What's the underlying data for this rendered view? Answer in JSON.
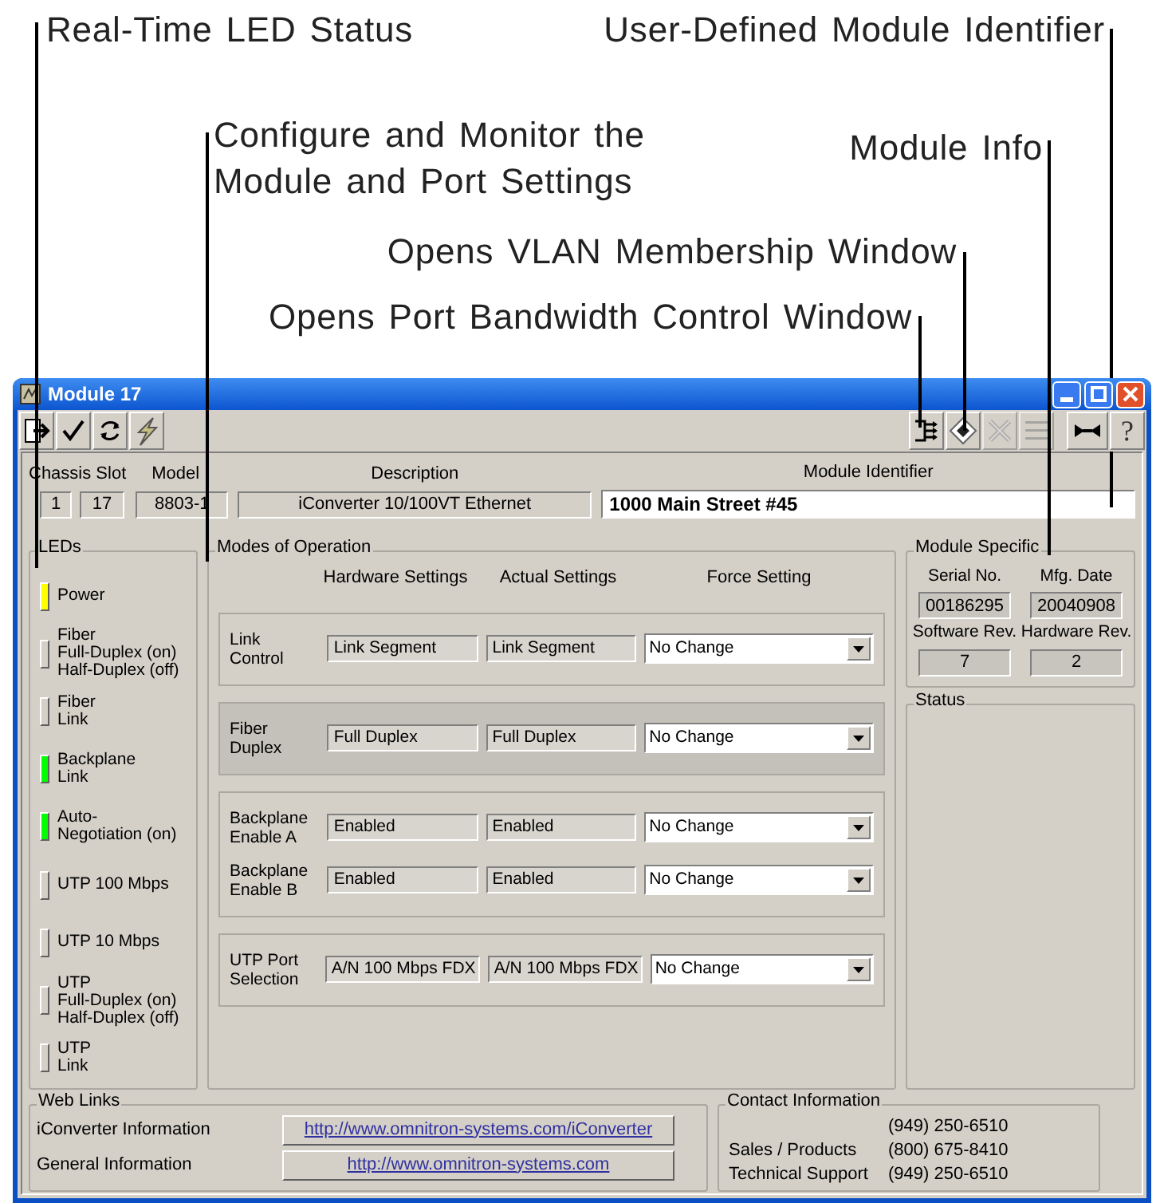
{
  "callouts": [
    {
      "text": "Real-Time LED Status"
    },
    {
      "text": "User-Defined Module Identifier"
    },
    {
      "text": "Configure and Monitor the\nModule and Port Settings"
    },
    {
      "text": "Module Info"
    },
    {
      "text": "Opens VLAN Membership Window"
    },
    {
      "text": "Opens Port Bandwidth Control Window"
    }
  ],
  "window": {
    "title": "Module 17"
  },
  "toolbar": {
    "left": [
      {
        "kind": "exit"
      },
      {
        "kind": "apply"
      },
      {
        "kind": "refresh"
      },
      {
        "kind": "reset"
      }
    ],
    "right": [
      {
        "kind": "bandwidth",
        "disabled": false
      },
      {
        "kind": "vlan",
        "disabled": false
      },
      {
        "kind": "cross",
        "disabled": true
      },
      {
        "kind": "binary",
        "disabled": true
      },
      {
        "kind": "loopback",
        "disabled": false
      },
      {
        "kind": "help",
        "label": "?",
        "disabled": false
      }
    ]
  },
  "module": {
    "chassis_label": "Chassis Slot",
    "chassis": "1",
    "slot": "17",
    "model_label": "Model",
    "model": "8803-1",
    "description_label": "Description",
    "description": "iConverter 10/100VT Ethernet",
    "identifier_label": "Module Identifier",
    "identifier": "1000 Main Street #45"
  },
  "leds": {
    "title": "LEDs",
    "items": [
      {
        "label": "Power",
        "color": "#ffff00"
      },
      {
        "label": "Fiber\nFull-Duplex (on)\nHalf-Duplex (off)",
        "color": "#d4d0c8"
      },
      {
        "label": "Fiber\nLink",
        "color": "#d4d0c8"
      },
      {
        "label": "Backplane\nLink",
        "color": "#00ff00"
      },
      {
        "label": "Auto-\nNegotiation (on)",
        "color": "#00ff00"
      },
      {
        "label": "UTP 100 Mbps",
        "color": "#d4d0c8"
      },
      {
        "label": "UTP 10 Mbps",
        "color": "#d4d0c8"
      },
      {
        "label": "UTP\nFull-Duplex (on)\nHalf-Duplex (off)",
        "color": "#d4d0c8"
      },
      {
        "label": "UTP\nLink",
        "color": "#d4d0c8"
      }
    ]
  },
  "modes": {
    "title": "Modes of Operation",
    "columns": [
      "Hardware Settings",
      "Actual Settings",
      "Force Setting"
    ],
    "groups": [
      {
        "highlighted": false,
        "settings": [
          {
            "label": "Link\nControl",
            "hardware": "Link Segment",
            "actual": "Link Segment",
            "force": "No Change"
          }
        ]
      },
      {
        "highlighted": true,
        "settings": [
          {
            "label": "Fiber\nDuplex",
            "hardware": "Full Duplex",
            "actual": "Full Duplex",
            "force": "No Change"
          }
        ]
      },
      {
        "highlighted": false,
        "settings": [
          {
            "label": "Backplane\nEnable A",
            "hardware": "Enabled",
            "actual": "Enabled",
            "force": "No Change"
          },
          {
            "label": "Backplane\nEnable B",
            "hardware": "Enabled",
            "actual": "Enabled",
            "force": "No Change"
          }
        ]
      },
      {
        "highlighted": false,
        "settings": [
          {
            "label": "UTP Port\nSelection",
            "hardware": "A/N 100 Mbps FDX",
            "actual": "A/N 100 Mbps FDX",
            "force": "No Change"
          }
        ]
      }
    ]
  },
  "module_specific": {
    "title": "Module Specific",
    "fields": [
      {
        "label": "Serial No.",
        "value": "00186295"
      },
      {
        "label": "Mfg. Date",
        "value": "20040908"
      },
      {
        "label": "Software Rev.",
        "value": "7"
      },
      {
        "label": "Hardware Rev.",
        "value": "2"
      }
    ]
  },
  "status": {
    "title": "Status"
  },
  "web_links": {
    "title": "Web Links",
    "links": [
      {
        "label": "iConverter Information",
        "url": "http://www.omnitron-systems.com/iConverter"
      },
      {
        "label": "General Information",
        "url": "http://www.omnitron-systems.com"
      }
    ]
  },
  "contact": {
    "title": "Contact Information",
    "rows": [
      {
        "label": "",
        "phone": "(949) 250-6510"
      },
      {
        "label": "Sales / Products",
        "phone": "(800) 675-8410"
      },
      {
        "label": "Technical Support",
        "phone": "(949) 250-6510"
      }
    ]
  }
}
